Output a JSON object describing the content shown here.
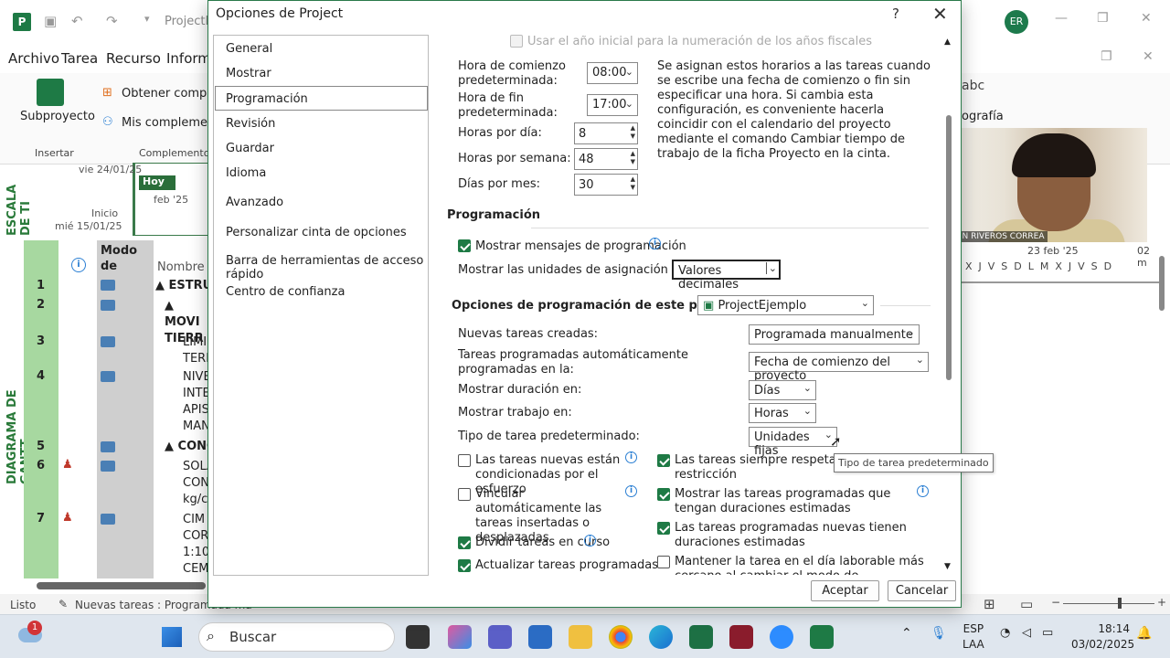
{
  "app": {
    "title": "ProjectEj",
    "user_initials": "ER",
    "ribbon_tabs": [
      "Archivo",
      "Tarea",
      "Recurso",
      "Informe"
    ],
    "ribbon_buttons": {
      "subproyecto": "Subproyecto",
      "obtener": "Obtener complem",
      "mis": "Mis complemento",
      "ortografia_abc": "abc",
      "ortografia": "ografía"
    },
    "ribbon_groups": [
      "Insertar",
      "Complementos"
    ],
    "timescale_label": "ESCALA DE TI",
    "gantt_label": "DIAGRAMA DE GANTT",
    "timeline": {
      "date_top": "vie 24/01/25",
      "hoy": "Hoy",
      "feb": "feb '25",
      "inicio": "Inicio",
      "date_start": "mié 15/01/25"
    },
    "grid_headers": {
      "mode": "Modo de",
      "name": "Nombre d"
    },
    "rows": [
      {
        "num": "1",
        "text": "▲ ESTRUC"
      },
      {
        "num": "2",
        "text": "▲ MOVI TIERR"
      },
      {
        "num": "3",
        "text": "LIMI TERR"
      },
      {
        "num": "4",
        "text": "NIVE INTE APIS MAN"
      },
      {
        "num": "5",
        "text": "▲ CONC"
      },
      {
        "num": "6",
        "text": "SOLA CON kg/c"
      },
      {
        "num": "7",
        "text": "CIM COR 1:10 CEM"
      }
    ],
    "calendar_right": {
      "week": "23 feb '25",
      "week2": "02 m",
      "days": "X  J  V  S  D  L  M  X  J  V  S  D"
    },
    "webcam_name": "ELVIN RIVEROS CORREA",
    "status": {
      "ready": "Listo",
      "new_tasks": "Nuevas tareas : Programada ma"
    }
  },
  "taskbar": {
    "search": "Buscar",
    "lang1": "ESP",
    "lang2": "LAA",
    "time": "18:14",
    "date": "03/02/2025",
    "badge": "1"
  },
  "dialog": {
    "title": "Opciones de Project",
    "help": "?",
    "nav": [
      "General",
      "Mostrar",
      "Programación",
      "Revisión",
      "Guardar",
      "Idioma",
      "Avanzado",
      "Personalizar cinta de opciones",
      "Barra de herramientas de acceso rápido",
      "Centro de confianza"
    ],
    "fiscal_year": "Usar el año inicial para la numeración de los años fiscales",
    "start_time_label": "Hora de comienzo predeterminada:",
    "start_time": "08:00",
    "end_time_label": "Hora de fin predeterminada:",
    "end_time": "17:00",
    "hours_day_label": "Horas por día:",
    "hours_day": "8",
    "hours_week_label": "Horas por semana:",
    "hours_week": "48",
    "days_month_label": "Días por mes:",
    "days_month": "30",
    "description": "Se asignan estos horarios a las tareas cuando se escribe una fecha de comienzo o fin sin especificar una hora. Si cambia esta configuración, es conveniente hacerla coincidir con el calendario del proyecto mediante el comando Cambiar tiempo de trabajo de la ficha Proyecto en la cinta.",
    "section_scheduling": "Programación",
    "show_msgs": "Mostrar mensajes de programación",
    "units_label": "Mostrar las unidades de asignación como:",
    "units_value": "Valores decimales",
    "project_options_label": "Opciones de programación de este proyecto:",
    "project_value": "ProjectEjemplo",
    "new_tasks_label": "Nuevas tareas creadas:",
    "new_tasks_value": "Programada manualmente",
    "auto_tasks_label": "Tareas programadas automáticamente programadas en la:",
    "auto_tasks_value": "Fecha de comienzo del proyecto",
    "duration_label": "Mostrar duración en:",
    "duration_value": "Días",
    "work_label": "Mostrar trabajo en:",
    "work_value": "Horas",
    "task_type_label": "Tipo de tarea predeterminado:",
    "task_type_value": "Unidades fijas",
    "tooltip": "Tipo de tarea predeterminado",
    "cb_effort": "Las tareas nuevas están condicionadas por el esfuerzo",
    "cb_link": "Vincular automáticamente las tareas insertadas o desplazadas",
    "cb_split": "Dividir tareas en curso",
    "cb_update": "Actualizar tareas programadas",
    "cb_respect": "Las tareas siempre respetan las fechas de restricción",
    "cb_respect_short": "Las tareas siempre respetan las fe",
    "cb_respect_2": "restricción",
    "cb_estimated": "Mostrar las tareas programadas que tengan duraciones estimadas",
    "cb_new_estimated": "Las tareas programadas nuevas tienen duraciones estimadas",
    "cb_keep": "Mantener la tarea en el día laborable más cercano al cambiar el modo de programación automática",
    "ok": "Aceptar",
    "cancel": "Cancelar"
  },
  "colors": {
    "accent": "#1e7a45",
    "gantt_green": "#a7d8a0",
    "info_blue": "#2b7fd3"
  }
}
